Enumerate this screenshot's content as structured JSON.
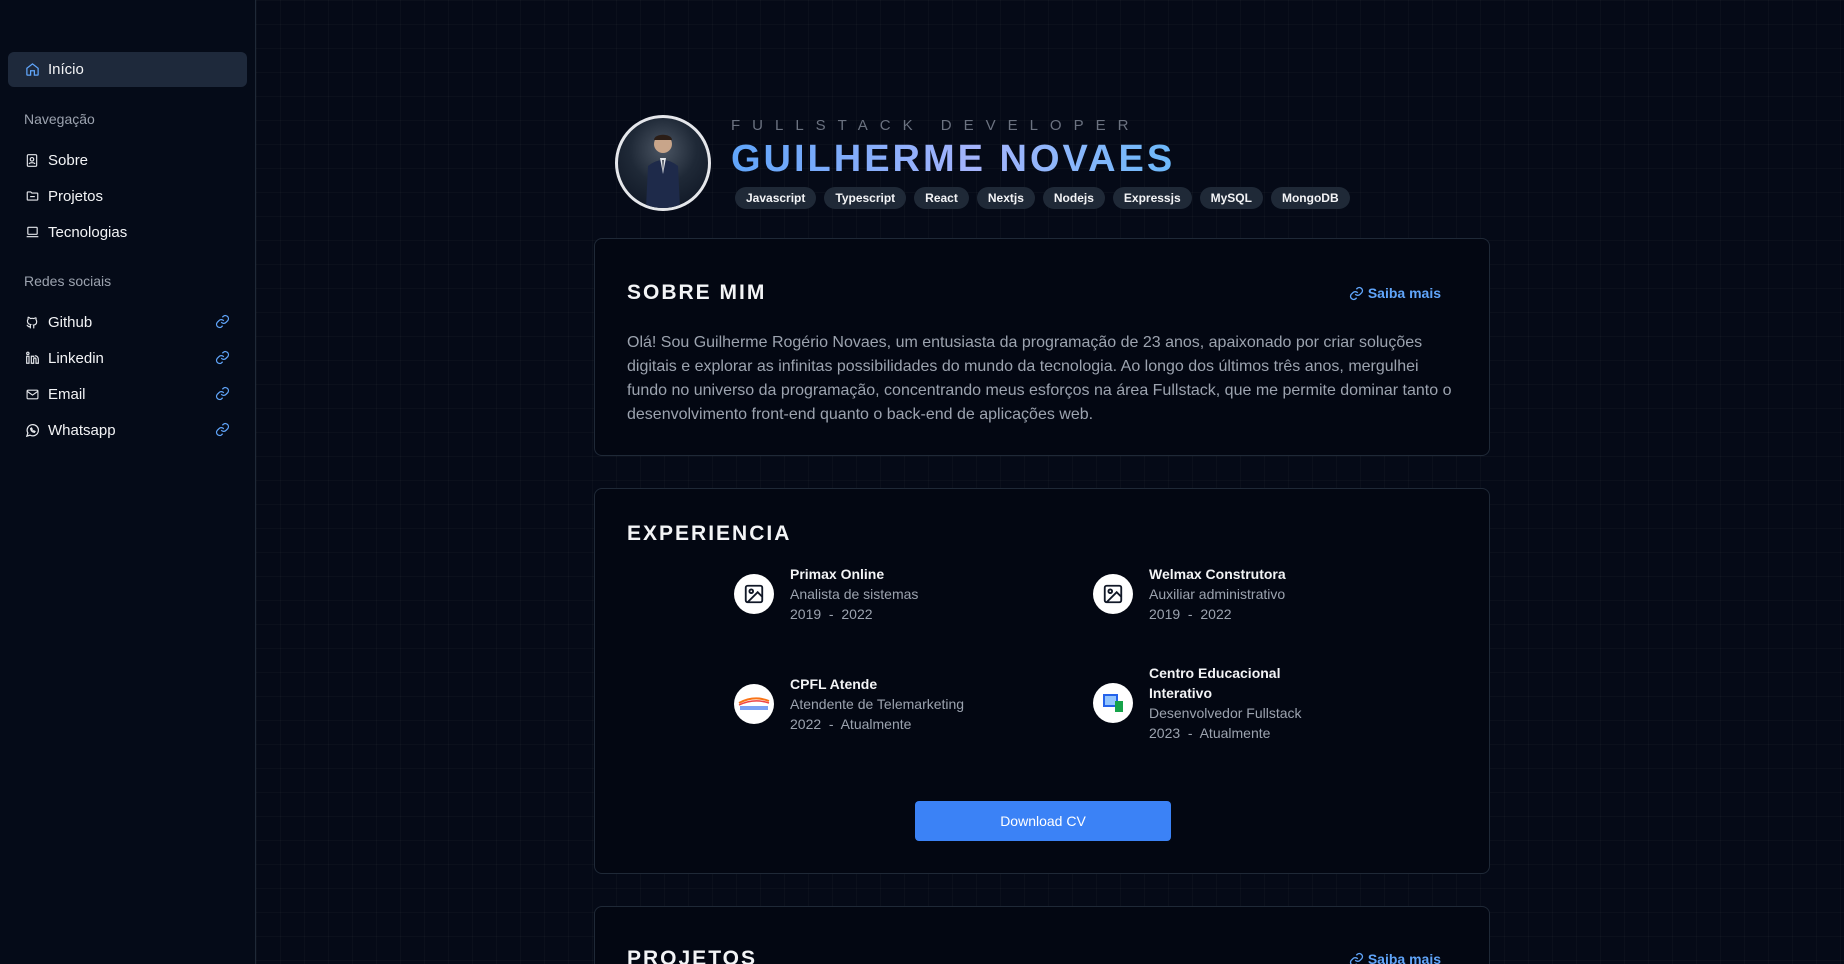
{
  "sidebar": {
    "home": {
      "label": "Início",
      "icon": "home-icon"
    },
    "nav_title": "Navegação",
    "nav": [
      {
        "label": "Sobre",
        "icon": "id-badge-icon"
      },
      {
        "label": "Projetos",
        "icon": "folder-icon"
      },
      {
        "label": "Tecnologias",
        "icon": "laptop-icon"
      }
    ],
    "social_title": "Redes sociais",
    "social": [
      {
        "label": "Github",
        "icon": "github-icon"
      },
      {
        "label": "Linkedin",
        "icon": "linkedin-icon"
      },
      {
        "label": "Email",
        "icon": "mail-icon"
      },
      {
        "label": "Whatsapp",
        "icon": "whatsapp-icon"
      }
    ]
  },
  "hero": {
    "role": "FULLSTACK DEVELOPER",
    "name": "GUILHERME NOVAES",
    "tags": [
      "Javascript",
      "Typescript",
      "React",
      "Nextjs",
      "Nodejs",
      "Expressjs",
      "MySQL",
      "MongoDB"
    ]
  },
  "about": {
    "title": "SOBRE MIM",
    "more": "Saiba mais",
    "text": "Olá! Sou Guilherme Rogério Novaes, um entusiasta da programação de 23 anos, apaixonado por criar soluções digitais e explorar as infinitas possibilidades do mundo da tecnologia. Ao longo dos últimos três anos, mergulhei fundo no universo da programação, concentrando meus esforços na área Fullstack, que me permite dominar tanto o desenvolvimento front-end quanto o back-end de aplicações web."
  },
  "experience": {
    "title": "EXPERIENCIA",
    "items": [
      {
        "company": "Primax Online",
        "role": "Analista de sistemas",
        "period": "2019  -  2022",
        "icon": "image-placeholder-icon"
      },
      {
        "company": "Welmax Construtora",
        "role": "Auxiliar administrativo",
        "period": "2019  -  2022",
        "icon": "image-placeholder-icon"
      },
      {
        "company": "CPFL Atende",
        "role": "Atendente de Telemarketing",
        "period": "2022  -  Atualmente",
        "icon": "cpfl-logo"
      },
      {
        "company": "Centro Educacional Interativo",
        "role": "Desenvolvedor Fullstack",
        "period": "2023  -  Atualmente",
        "icon": "cei-logo"
      }
    ],
    "download": "Download CV"
  },
  "projects": {
    "title": "PROJETOS",
    "more": "Saiba mais"
  },
  "colors": {
    "accent": "#3b82f6",
    "link": "#60a5fa",
    "background": "#030712"
  }
}
